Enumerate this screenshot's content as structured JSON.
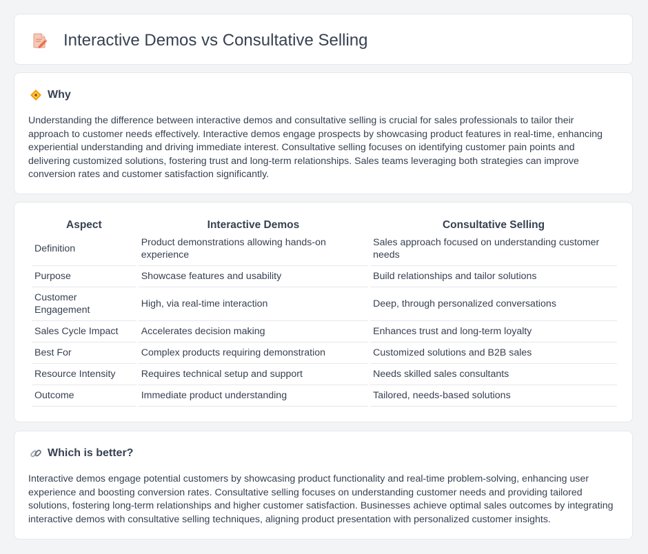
{
  "header": {
    "title": "Interactive Demos vs Consultative Selling",
    "icon": "document-pencil-icon"
  },
  "why": {
    "title": "Why",
    "icon": "diamond-badge-icon",
    "text": "Understanding the difference between interactive demos and consultative selling is crucial for sales professionals to tailor their approach to customer needs effectively. Interactive demos engage prospects by showcasing product features in real-time, enhancing experiential understanding and driving immediate interest. Consultative selling focuses on identifying customer pain points and delivering customized solutions, fostering trust and long-term relationships. Sales teams leveraging both strategies can improve conversion rates and customer satisfaction significantly."
  },
  "table": {
    "headers": [
      "Aspect",
      "Interactive Demos",
      "Consultative Selling"
    ],
    "rows": [
      [
        "Definition",
        "Product demonstrations allowing hands-on experience",
        "Sales approach focused on understanding customer needs"
      ],
      [
        "Purpose",
        "Showcase features and usability",
        "Build relationships and tailor solutions"
      ],
      [
        "Customer Engagement",
        "High, via real-time interaction",
        "Deep, through personalized conversations"
      ],
      [
        "Sales Cycle Impact",
        "Accelerates decision making",
        "Enhances trust and long-term loyalty"
      ],
      [
        "Best For",
        "Complex products requiring demonstration",
        "Customized solutions and B2B sales"
      ],
      [
        "Resource Intensity",
        "Requires technical setup and support",
        "Needs skilled sales consultants"
      ],
      [
        "Outcome",
        "Immediate product understanding",
        "Tailored, needs-based solutions"
      ]
    ]
  },
  "better": {
    "title": "Which is better?",
    "icon": "link-icon",
    "text": "Interactive demos engage potential customers by showcasing product functionality and real-time problem-solving, enhancing user experience and boosting conversion rates. Consultative selling focuses on understanding customer needs and providing tailored solutions, fostering long-term relationships and higher customer satisfaction. Businesses achieve optimal sales outcomes by integrating interactive demos with consultative selling techniques, aligning product presentation with personalized customer insights."
  }
}
